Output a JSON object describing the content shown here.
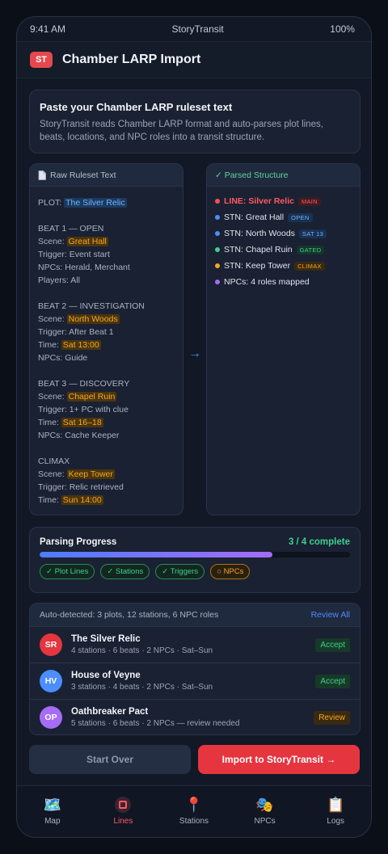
{
  "status_bar": {
    "time": "9:41 AM",
    "app_name": "StoryTransit",
    "battery": "100%"
  },
  "header": {
    "logo_text": "ST",
    "title": "Chamber LARP Import"
  },
  "intro": {
    "title": "Paste your Chamber LARP ruleset text",
    "description": "StoryTransit reads Chamber LARP format and auto-parses plot lines, beats, locations, and NPC roles into a transit structure."
  },
  "raw_panel": {
    "header": "Raw Ruleset Text",
    "plot_label": "PLOT: ",
    "plot_value": "The Silver Relic",
    "beats": [
      {
        "title": "BEAT 1 — OPEN",
        "scene_label": "Scene: ",
        "scene": "Great Hall",
        "trigger": "Trigger: Event start",
        "npcs": "NPCs: Herald, Merchant",
        "extra": "Players: All"
      },
      {
        "title": "BEAT 2 — INVESTIGATION",
        "scene_label": "Scene: ",
        "scene": "North Woods",
        "trigger": "Trigger: After Beat 1",
        "time_label": "Time: ",
        "time": "Sat 13:00",
        "npcs": "NPCs: Guide"
      },
      {
        "title": "BEAT 3 — DISCOVERY",
        "scene_label": "Scene: ",
        "scene": "Chapel Ruin",
        "trigger": "Trigger: 1+ PC with clue",
        "time_label": "Time: ",
        "time": "Sat 16–18",
        "npcs": "NPCs: Cache Keeper"
      },
      {
        "title": "CLIMAX",
        "scene_label": "Scene: ",
        "scene": "Keep Tower",
        "trigger": "Trigger: Relic retrieved",
        "time_label": "Time: ",
        "time": "Sun 14:00"
      }
    ]
  },
  "parsed_panel": {
    "header": "✓ Parsed Structure",
    "rows": [
      {
        "text": "LINE: Silver Relic",
        "tag": "MAIN",
        "dot_color": "#ff4d52",
        "tag_color": "#ff5a5f",
        "tag_bg": "#3d1c22"
      },
      {
        "text": "STN: Great Hall",
        "tag": "OPEN",
        "dot_color": "#4c8dff",
        "tag_color": "#6fb2ff",
        "tag_bg": "#1a3152"
      },
      {
        "text": "STN: North Woods",
        "tag": "SAT 13",
        "dot_color": "#4c8dff",
        "tag_color": "#6fb2ff",
        "tag_bg": "#1a3152"
      },
      {
        "text": "STN: Chapel Ruin",
        "tag": "GATED",
        "dot_color": "#3ecf8e",
        "tag_color": "#3ecf8e",
        "tag_bg": "#15352a"
      },
      {
        "text": "STN: Keep Tower",
        "tag": "CLIMAX",
        "dot_color": "#f5a623",
        "tag_color": "#f5a623",
        "tag_bg": "#3a2a10"
      },
      {
        "text": "NPCs: 4 roles mapped",
        "tag": "",
        "dot_color": "#a56cf5",
        "tag_color": "",
        "tag_bg": ""
      }
    ]
  },
  "progress": {
    "title": "Parsing Progress",
    "count": "3 / 4 complete",
    "fraction": 0.75,
    "chips": [
      {
        "label": "✓ Plot Lines",
        "done": true
      },
      {
        "label": "✓ Stations",
        "done": true
      },
      {
        "label": "✓ Triggers",
        "done": true
      },
      {
        "label": "○ NPCs",
        "done": false
      }
    ]
  },
  "detected": {
    "summary": "Auto-detected: 3 plots, 12 stations, 6 NPC roles",
    "review_all": "Review All",
    "items": [
      {
        "initials": "SR",
        "name": "The Silver Relic",
        "meta": "4 stations · 6 beats · 2 NPCs · Sat–Sun",
        "action": "Accept",
        "avatar_color": "#e5353f"
      },
      {
        "initials": "HV",
        "name": "House of Veyne",
        "meta": "3 stations · 4 beats · 2 NPCs · Sat–Sun",
        "action": "Accept",
        "avatar_color": "#4c8dff"
      },
      {
        "initials": "OP",
        "name": "Oathbreaker Pact",
        "meta": "5 stations · 6 beats · 2 NPCs — review needed",
        "action": "Review",
        "avatar_color": "#a56cf5"
      }
    ]
  },
  "actions": {
    "start_over": "Start Over",
    "import": "Import to StoryTransit →"
  },
  "tabs": [
    {
      "label": "Map",
      "icon": "map-icon",
      "glyph": "🗺️",
      "active": false
    },
    {
      "label": "Lines",
      "icon": "lines-icon",
      "glyph": "",
      "active": true
    },
    {
      "label": "Stations",
      "icon": "pin-icon",
      "glyph": "📍",
      "active": false
    },
    {
      "label": "NPCs",
      "icon": "masks-icon",
      "glyph": "🎭",
      "active": false
    },
    {
      "label": "Logs",
      "icon": "clipboard-icon",
      "glyph": "📋",
      "active": false
    }
  ]
}
